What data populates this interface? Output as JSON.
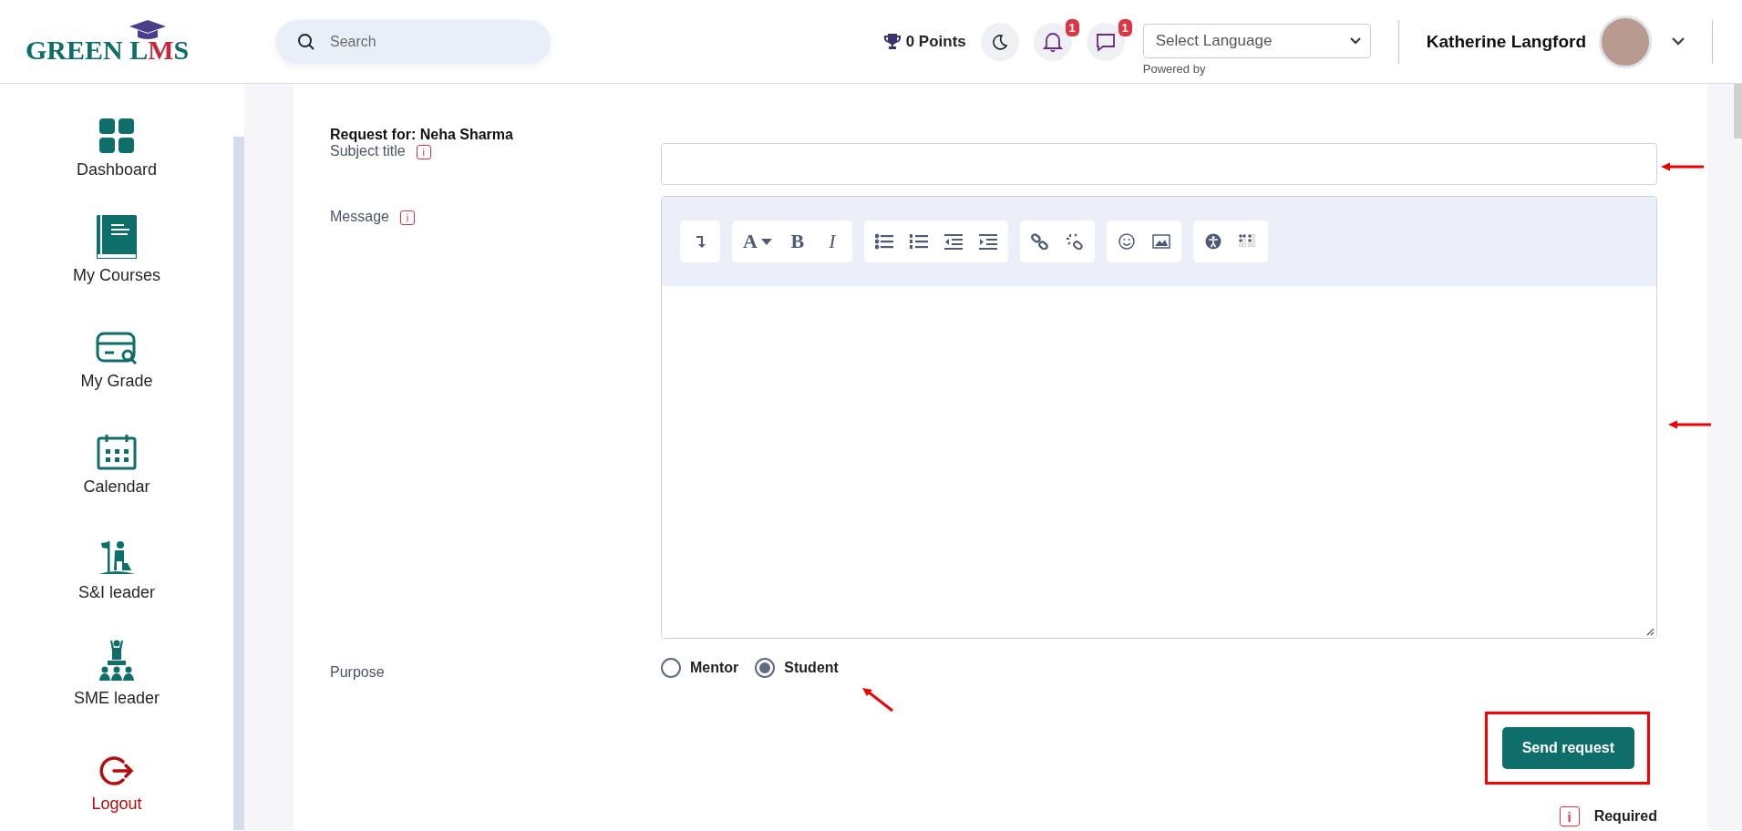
{
  "header": {
    "logo": {
      "part_1": "GREEN L",
      "part_2": "M",
      "part_3": "S"
    },
    "search": {
      "placeholder": "Search"
    },
    "points": "0 Points",
    "notifications": {
      "badge": "1"
    },
    "messages": {
      "badge": "1"
    },
    "language": {
      "placeholder": "Select Language",
      "note": "Powered by"
    },
    "user": {
      "name": "Katherine Langford"
    }
  },
  "sidebar": {
    "items": [
      {
        "label": "Dashboard",
        "kind": "nav"
      },
      {
        "label": "My Courses",
        "kind": "nav"
      },
      {
        "label": "My Grade",
        "kind": "nav"
      },
      {
        "label": "Calendar",
        "kind": "nav"
      },
      {
        "label": "S&I leader",
        "kind": "nav"
      },
      {
        "label": "SME leader",
        "kind": "nav"
      },
      {
        "label": "Logout",
        "kind": "logout"
      }
    ]
  },
  "form": {
    "request_for": "Request for: Neha Sharma",
    "subject_label": "Subject title",
    "subject_info_glyph": "i",
    "message_label": "Message",
    "message_info_glyph": "i",
    "toolbar": {
      "font_glyph": "A",
      "bold_glyph": "B",
      "italic_glyph": "I"
    },
    "purpose_label": "Purpose",
    "purpose_options": [
      {
        "label": "Mentor",
        "selected": false
      },
      {
        "label": "Student",
        "selected": true
      }
    ],
    "submit": "Send request",
    "required_glyph": "i",
    "required_note": "Required"
  }
}
